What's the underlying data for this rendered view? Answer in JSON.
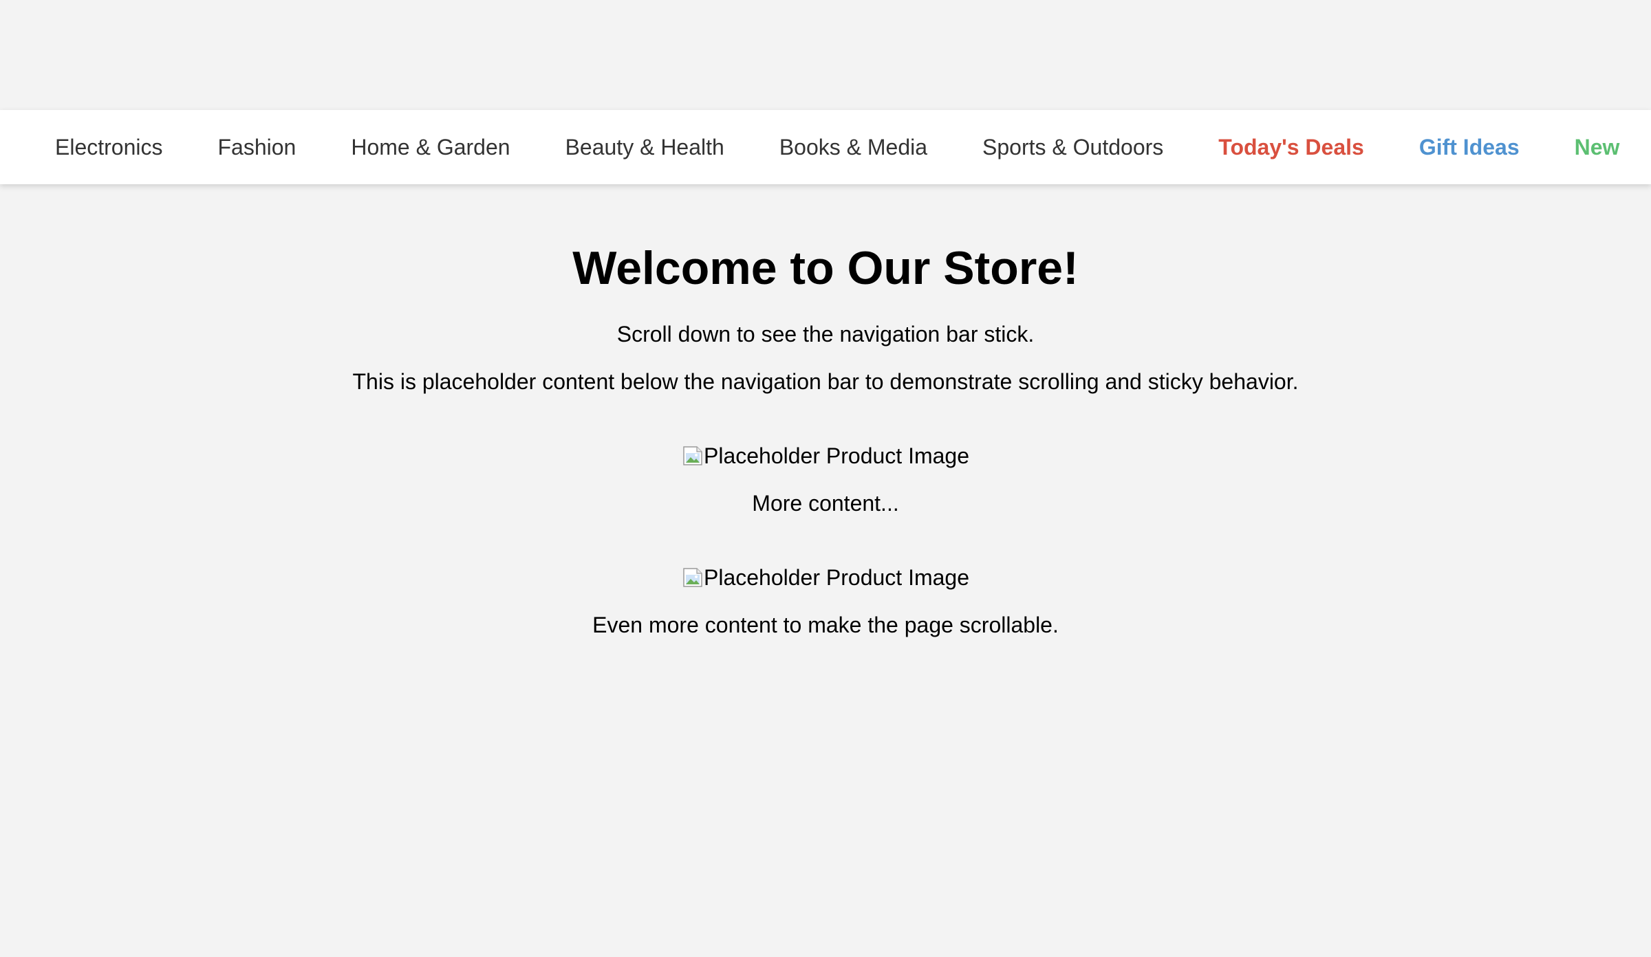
{
  "nav": {
    "items": [
      {
        "label": "Electronics",
        "style": "normal"
      },
      {
        "label": "Fashion",
        "style": "normal"
      },
      {
        "label": "Home & Garden",
        "style": "normal"
      },
      {
        "label": "Beauty & Health",
        "style": "normal"
      },
      {
        "label": "Books & Media",
        "style": "normal"
      },
      {
        "label": "Sports & Outdoors",
        "style": "normal"
      },
      {
        "label": "Today's Deals",
        "style": "deals",
        "color": "#d9503f"
      },
      {
        "label": "Gift Ideas",
        "style": "gifts",
        "color": "#4f92d0"
      },
      {
        "label": "New",
        "style": "new",
        "color": "#5cbf72"
      }
    ]
  },
  "main": {
    "title": "Welcome to Our Store!",
    "intro": "Scroll down to see the navigation bar stick.",
    "placeholder": "This is placeholder content below the navigation bar to demonstrate scrolling and sticky behavior.",
    "product1_alt": "Placeholder Product Image",
    "more": "More content...",
    "product2_alt": "Placeholder Product Image",
    "even_more": "Even more content to make the page scrollable."
  },
  "colors": {
    "background": "#f3f3f3",
    "nav_background": "#ffffff",
    "nav_text": "#333333",
    "deals": "#d9503f",
    "gifts": "#4f92d0",
    "new": "#5cbf72"
  }
}
